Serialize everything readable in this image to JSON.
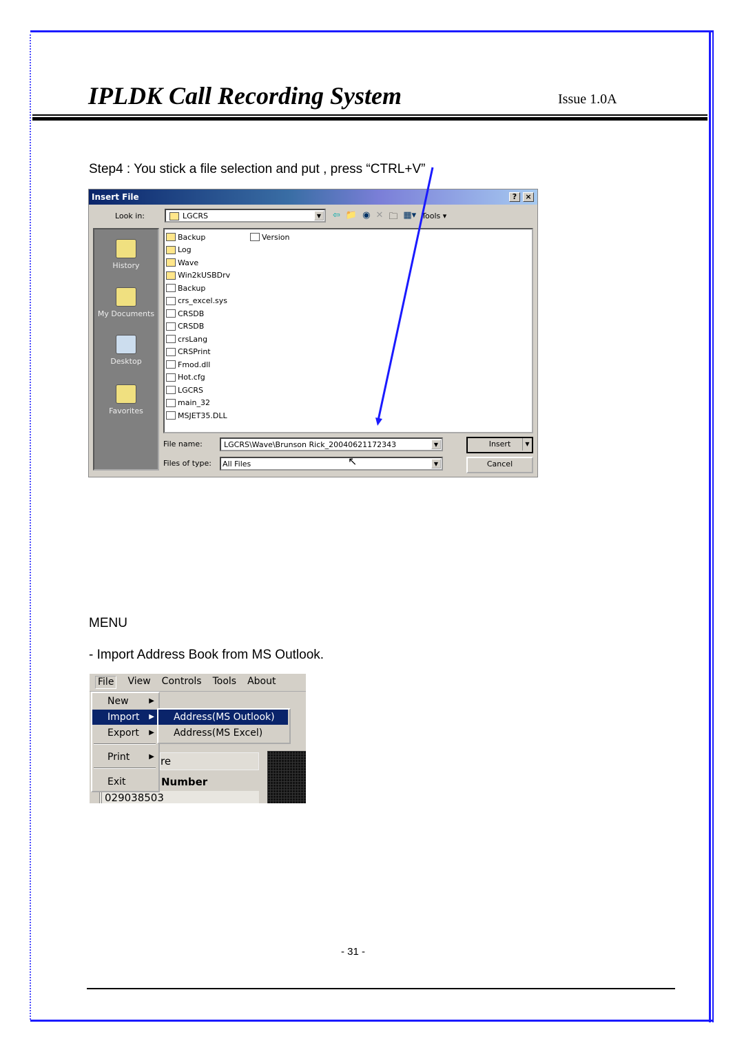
{
  "header": {
    "title": "IPLDK Call Recording System",
    "issue": "Issue 1.0A"
  },
  "step4": "Step4 : You stick a file selection and put , press “CTRL+V”",
  "dialog": {
    "title": "Insert File",
    "help": "?",
    "close": "×",
    "look_in_label": "Look in:",
    "look_in_value": "LGCRS",
    "tools_label": "Tools",
    "sidebar": [
      "History",
      "My Documents",
      "Desktop",
      "Favorites"
    ],
    "files_col1": [
      {
        "name": "Backup",
        "icon": "folder"
      },
      {
        "name": "Log",
        "icon": "folder"
      },
      {
        "name": "Wave",
        "icon": "folder"
      },
      {
        "name": "Win2kUSBDrv",
        "icon": "folder"
      },
      {
        "name": "Backup",
        "icon": "file"
      },
      {
        "name": "crs_excel.sys",
        "icon": "file"
      },
      {
        "name": "CRSDB",
        "icon": "file"
      },
      {
        "name": "CRSDB",
        "icon": "file"
      },
      {
        "name": "crsLang",
        "icon": "file"
      },
      {
        "name": "CRSPrint",
        "icon": "file"
      },
      {
        "name": "Fmod.dll",
        "icon": "file"
      },
      {
        "name": "Hot.cfg",
        "icon": "file"
      },
      {
        "name": "LGCRS",
        "icon": "file"
      },
      {
        "name": "main_32",
        "icon": "file"
      },
      {
        "name": "MSJET35.DLL",
        "icon": "file"
      }
    ],
    "files_col2": [
      {
        "name": "Version",
        "icon": "file"
      }
    ],
    "file_name_label": "File name:",
    "file_name_value": "LGCRS\\Wave\\Brunson Rick_20040621172343",
    "file_type_label": "Files of type:",
    "file_type_value": "All Files",
    "insert_label": "Insert",
    "cancel_label": "Cancel",
    "arrow_color": "#1a1aff"
  },
  "menu_heading": "MENU",
  "import_text": "- Import Address Book from MS Outlook.",
  "menubar": [
    "File",
    "View",
    "Controls",
    "Tools",
    "About"
  ],
  "file_menu": [
    "New",
    "Import",
    "Export",
    "Print",
    "Exit"
  ],
  "submenu": [
    "Address(MS Outlook)",
    "Address(MS Excel)"
  ],
  "background_text": {
    "partial": "re",
    "number_label": "Number",
    "number_value": "029038503"
  },
  "footer": {
    "page": "- 31 -"
  }
}
